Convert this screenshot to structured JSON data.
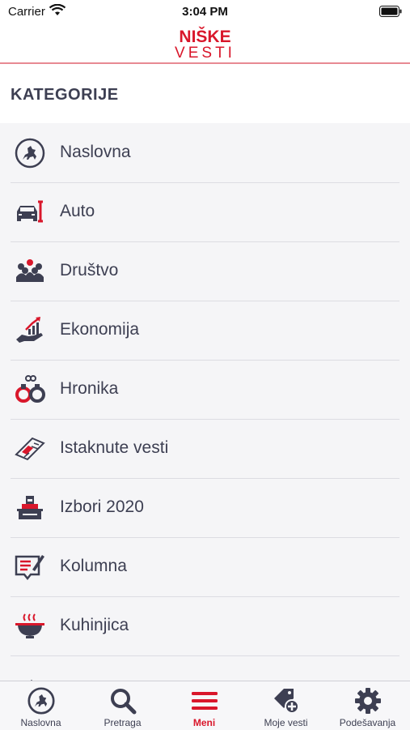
{
  "status_bar": {
    "carrier": "Carrier",
    "time": "3:04 PM"
  },
  "header": {
    "logo_line1": "NIŠKE",
    "logo_line2": "VESTI"
  },
  "section": {
    "title": "KATEGORIJE"
  },
  "categories": [
    {
      "label": "Naslovna",
      "icon": "horseman-emblem-icon"
    },
    {
      "label": "Auto",
      "icon": "car-wrench-icon"
    },
    {
      "label": "Društvo",
      "icon": "people-group-icon"
    },
    {
      "label": "Ekonomija",
      "icon": "hand-growth-chart-icon"
    },
    {
      "label": "Hronika",
      "icon": "handcuffs-icon"
    },
    {
      "label": "Istaknute vesti",
      "icon": "newspaper-icon"
    },
    {
      "label": "Izbori 2020",
      "icon": "ballot-box-icon"
    },
    {
      "label": "Kolumna",
      "icon": "column-writing-icon"
    },
    {
      "label": "Kuhinjica",
      "icon": "cooking-pot-icon"
    }
  ],
  "tabs": [
    {
      "label": "Naslovna",
      "icon": "horseman-emblem-icon",
      "active": false
    },
    {
      "label": "Pretraga",
      "icon": "search-icon",
      "active": false
    },
    {
      "label": "Meni",
      "icon": "menu-icon",
      "active": true
    },
    {
      "label": "Moje vesti",
      "icon": "tag-add-icon",
      "active": false
    },
    {
      "label": "Podešavanja",
      "icon": "gear-icon",
      "active": false
    }
  ],
  "colors": {
    "brand_red": "#d9172b",
    "icon_gray": "#3d3f52",
    "list_bg": "#f5f5f7"
  }
}
